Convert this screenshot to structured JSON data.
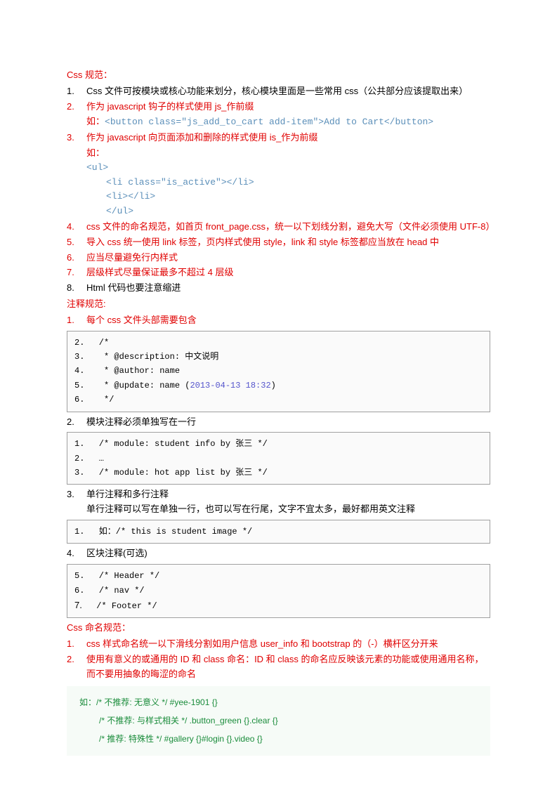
{
  "title": "Css 规范：",
  "main_items": [
    {
      "num": "1.",
      "text": "Css 文件可按模块或核心功能来划分，核心模块里面是一些常用 css（公共部分应该提取出来）",
      "red": false
    },
    {
      "num": "2.",
      "text": "作为 javascript 钩子的样式使用 js_作前缀",
      "red": true
    },
    {
      "num": "",
      "sub": "如：",
      "code": "<button class=\"js_add_to_cart add-item\">Add to Cart</button>",
      "red": true
    },
    {
      "num": "3.",
      "text": "作为 javascript 向页面添加和删除的样式使用 is_作为前缀",
      "red": true
    },
    {
      "num": "",
      "sub": "如：",
      "code_block": [
        "<ul>",
        "        <li class=\"is_active\"></li>",
        "        <li></li>",
        "</ul>"
      ],
      "red": true
    },
    {
      "num": "4.",
      "text": "css 文件的命名规范，如首页 front_page.css，统一以下划线分割，避免大写（文件必须使用 UTF-8）",
      "red": true
    },
    {
      "num": "5.",
      "text": "导入 css 统一使用 link 标签，页内样式使用 style，link 和 style 标签都应当放在 head 中",
      "red": true
    },
    {
      "num": "6.",
      "text": "应当尽量避免行内样式",
      "red": true
    },
    {
      "num": "7.",
      "text": "层级样式尽量保证最多不超过 4 层级",
      "red": true
    },
    {
      "num": "8.",
      "text": "Html 代码也要注意缩进",
      "red": false
    }
  ],
  "comment_title": "注释规范:",
  "comment_1_num": "1.",
  "comment_1_text": "每个 css 文件头部需要包含",
  "codebox1": {
    "lines": [
      {
        "n": "2.",
        "t": "/*"
      },
      {
        "n": "3.",
        "t": " * @description: 中文说明"
      },
      {
        "n": "4.",
        "t": " * @author: name"
      },
      {
        "n": "5.",
        "t": " * @update: name (",
        "date": "2013-04-13 18:32",
        "t2": ")"
      },
      {
        "n": "6.",
        "t": " */"
      }
    ]
  },
  "comment_2_num": "2.",
  "comment_2_text": "模块注释必须单独写在一行",
  "codebox2": {
    "lines": [
      {
        "n": "1.",
        "t": "/* module: student info by 张三 */"
      },
      {
        "n": "2.",
        "t": "…"
      },
      {
        "n": "3.",
        "t": "/* module: hot app list by 张三 */"
      }
    ]
  },
  "comment_3_num": "3.",
  "comment_3_text": "单行注释和多行注释",
  "comment_3_sub": "单行注释可以写在单独一行，也可以写在行尾，文字不宜太多，最好都用英文注释",
  "codebox3": {
    "lines": [
      {
        "n": "1.",
        "t": "如：/* this is student image */"
      }
    ]
  },
  "comment_4_num": "4.",
  "comment_4_text": "区块注释(可选)",
  "codebox4": {
    "lines": [
      {
        "n": "5.",
        "t": "/* Header */"
      },
      {
        "n": "6.",
        "t": "/* nav */"
      },
      {
        "n": "7.",
        "t": "/* Footer */",
        "big": true
      }
    ]
  },
  "naming_title": "Css 命名规范：",
  "naming_items": [
    {
      "num": "1.",
      "text": "css 样式命名统一以下滑线分割如用户信息 user_info 和 bootstrap 的（-）横杆区分开来",
      "red": true
    },
    {
      "num": "2.",
      "text": "使用有意义的或通用的 ID 和 class 命名：ID 和 class 的命名应反映该元素的功能或使用通用名称，而不要用抽象的晦涩的命名",
      "red": true
    }
  ],
  "example": {
    "l1": "如：/* 不推荐: 无意义 */ #yee-1901 {}",
    "l2": "/* 不推荐: 与样式相关 */ .button_green {}.clear {}",
    "l3": "/* 推荐: 特殊性 */ #gallery {}#login {}.video {}"
  }
}
